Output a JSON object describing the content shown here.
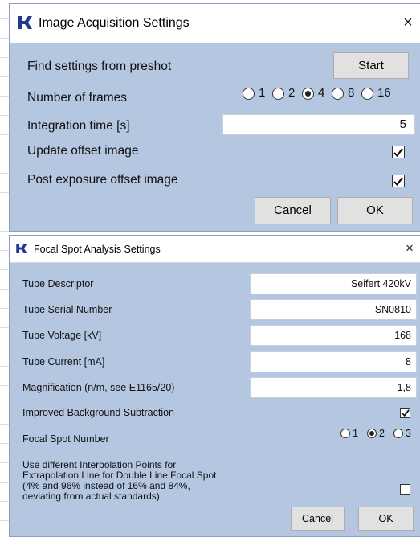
{
  "acquisition": {
    "title": "Image Acquisition Settings",
    "close_symbol": "×",
    "icon": "app-logo-icon",
    "preshot_label": "Find settings from preshot",
    "start_label": "Start",
    "frames_label": "Number of frames",
    "frames_options": [
      "1",
      "2",
      "4",
      "8",
      "16"
    ],
    "frames_selected": "4",
    "integration_label": "Integration time [s]",
    "integration_value": "5",
    "update_offset_label": "Update offset image",
    "update_offset_checked": true,
    "post_exposure_label": "Post exposure offset image",
    "post_exposure_checked": true,
    "cancel_label": "Cancel",
    "ok_label": "OK"
  },
  "focal": {
    "title": "Focal Spot Analysis Settings",
    "close_symbol": "×",
    "icon": "app-logo-icon",
    "tube_descriptor_label": "Tube Descriptor",
    "tube_descriptor_value": "Seifert 420kV",
    "tube_serial_label": "Tube Serial Number",
    "tube_serial_value": "SN0810",
    "tube_voltage_label": "Tube Voltage [kV]",
    "tube_voltage_value": "168",
    "tube_current_label": "Tube Current [mA]",
    "tube_current_value": "8",
    "magnification_label": "Magnification (n/m, see E1165/20)",
    "magnification_value": "1,8",
    "bg_subtraction_label": "Improved Background Subtraction",
    "bg_subtraction_checked": true,
    "spot_number_label": "Focal Spot Number",
    "spot_options": [
      "1",
      "2",
      "3"
    ],
    "spot_selected": "2",
    "interp_line1": "Use different Interpolation Points for",
    "interp_line2": "Extrapolation Line for Double Line Focal Spot",
    "interp_line3": "(4% and 96% instead of 16% and 84%,",
    "interp_line4": "deviating from actual standards)",
    "interp_checked": false,
    "cancel_label": "Cancel",
    "ok_label": "OK"
  },
  "colors": {
    "dialog_bg": "#b4c6e0",
    "logo": "#1f3a93"
  }
}
